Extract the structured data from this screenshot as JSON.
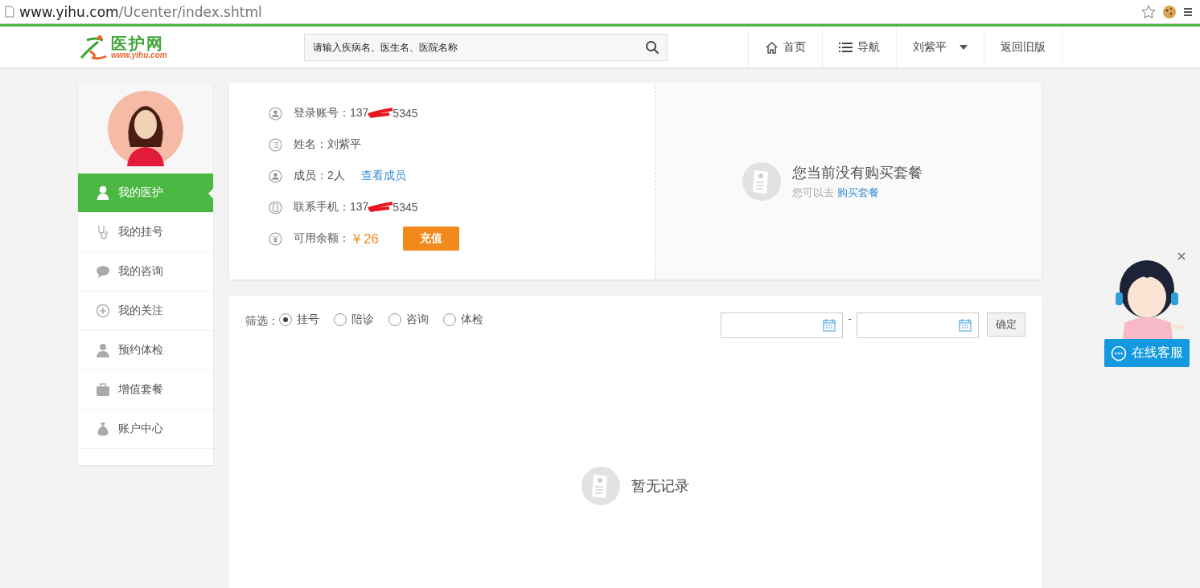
{
  "browser": {
    "url_host": "www.yihu.com",
    "url_path": "/Ucenter/index.shtml"
  },
  "header": {
    "logo_text": "医护网",
    "logo_sub": "www.yihu.com",
    "search": {
      "placeholder": "请输入疾病名、医生名、医院名称"
    },
    "nav": [
      {
        "kind": "home",
        "label": "首页"
      },
      {
        "kind": "list",
        "label": "导航"
      },
      {
        "kind": "dropdown",
        "label": "刘紫平"
      },
      {
        "kind": "plain",
        "label": "返回旧版"
      }
    ]
  },
  "sidebar": {
    "items": [
      {
        "label": "我的医护",
        "selected": true
      },
      {
        "label": "我的挂号",
        "selected": false
      },
      {
        "label": "我的咨询",
        "selected": false
      },
      {
        "label": "我的关注",
        "selected": false
      },
      {
        "label": "预约体检",
        "selected": false
      },
      {
        "label": "增值套餐",
        "selected": false
      },
      {
        "label": "账户中心",
        "selected": false
      }
    ]
  },
  "profile": {
    "rows": [
      {
        "label": "登录账号：",
        "value_start": "137",
        "value_end": "5345",
        "redacted": true
      },
      {
        "label": "姓名：刘紫平"
      },
      {
        "label": "成员：2人",
        "link": "查看成员"
      },
      {
        "label": "联系手机：",
        "value_start": "137",
        "value_end": "5345",
        "redacted": true
      }
    ],
    "balance": {
      "label": "可用余额：",
      "amount": "￥26",
      "button": "充值"
    }
  },
  "package": {
    "title": "您当前没有购买套餐",
    "hint": "您可以去",
    "link": "购买套餐"
  },
  "filter": {
    "label": "筛选：",
    "options": [
      {
        "label": "挂号",
        "selected": true
      },
      {
        "label": "陪诊",
        "selected": false
      },
      {
        "label": "咨询",
        "selected": false
      },
      {
        "label": "体检",
        "selected": false
      }
    ],
    "separator": "-",
    "confirm": "确定"
  },
  "empty": {
    "text": "暂无记录"
  },
  "chat_widget": {
    "button": "在线客服"
  }
}
